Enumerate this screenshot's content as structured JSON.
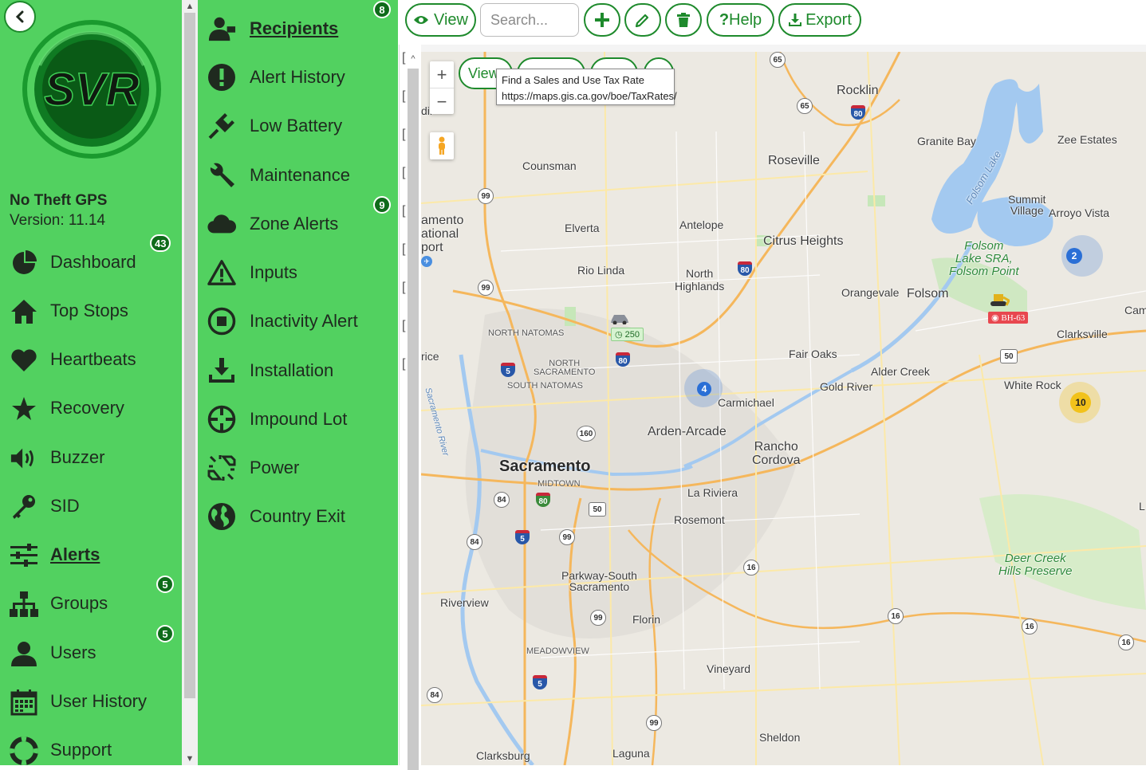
{
  "app": {
    "name": "No Theft GPS",
    "version": "Version: 11.14",
    "logo_text": "SVR"
  },
  "sidebar": {
    "items": [
      {
        "label": "Dashboard",
        "badge": "43",
        "icon": "dashboard-pie-icon"
      },
      {
        "label": "Top Stops",
        "badge": "",
        "icon": "home-icon"
      },
      {
        "label": "Heartbeats",
        "badge": "",
        "icon": "heart-icon"
      },
      {
        "label": "Recovery",
        "badge": "",
        "icon": "star-icon"
      },
      {
        "label": "Buzzer",
        "badge": "",
        "icon": "speaker-icon"
      },
      {
        "label": "SID",
        "badge": "",
        "icon": "key-icon"
      },
      {
        "label": "Alerts",
        "badge": "",
        "icon": "sliders-icon",
        "active": true
      },
      {
        "label": "Groups",
        "badge": "5",
        "icon": "sitemap-icon"
      },
      {
        "label": "Users",
        "badge": "5",
        "icon": "user-icon"
      },
      {
        "label": "User History",
        "badge": "",
        "icon": "calendar-icon"
      },
      {
        "label": "Support",
        "badge": "",
        "icon": "lifebuoy-icon"
      }
    ]
  },
  "alerts_menu": {
    "items": [
      {
        "label": "Recipients",
        "badge": "8",
        "icon": "recipients-icon",
        "active": true
      },
      {
        "label": "Alert History",
        "badge": "",
        "icon": "exclamation-circle-icon"
      },
      {
        "label": "Low Battery",
        "badge": "",
        "icon": "plug-icon"
      },
      {
        "label": "Maintenance",
        "badge": "",
        "icon": "wrench-icon"
      },
      {
        "label": "Zone Alerts",
        "badge": "9",
        "icon": "cloud-icon"
      },
      {
        "label": "Inputs",
        "badge": "",
        "icon": "warning-triangle-icon"
      },
      {
        "label": "Inactivity Alert",
        "badge": "",
        "icon": "stop-circle-icon"
      },
      {
        "label": "Installation",
        "badge": "",
        "icon": "download-icon"
      },
      {
        "label": "Impound Lot",
        "badge": "",
        "icon": "crosshair-icon"
      },
      {
        "label": "Power",
        "badge": "",
        "icon": "unplug-icon"
      },
      {
        "label": "Country Exit",
        "badge": "",
        "icon": "globe-icon"
      }
    ]
  },
  "toolbar": {
    "view_label": "View",
    "search_placeholder": "Search...",
    "help_label": "Help",
    "help_prefix": "?",
    "export_label": "Export"
  },
  "map": {
    "view_label": "View",
    "zoom_in": "+",
    "zoom_out": "−",
    "partial_text": "dir",
    "left_partial": [
      "amento",
      "ational",
      "port",
      "rice"
    ],
    "tooltip": {
      "line1": "Find a Sales and Use Tax Rate",
      "line2": "https://maps.gis.ca.gov/boe/TaxRates/"
    },
    "places": {
      "rocklin": "Rocklin",
      "granite_bay": "Granite Bay",
      "zee_estates": "Zee Estates",
      "roseville": "Roseville",
      "counsman": "Counsman",
      "summit_village": "Summit\nVillage",
      "arroyo_vista": "Arroyo Vista",
      "elverta": "Elverta",
      "antelope": "Antelope",
      "citrus_heights": "Citrus Heights",
      "rio_linda": "Rio Linda",
      "north_highlands": "North\nHighlands",
      "orangevale": "Orangevale",
      "folsom": "Folsom",
      "folsom_lake": "Folsom Lake",
      "folsom_sra": "Folsom\nLake SRA,\nFolsom Point",
      "cam": "Cam",
      "north_natomas": "NORTH NATOMAS",
      "clarksville": "Clarksville",
      "fair_oaks": "Fair Oaks",
      "north_sacramento": "NORTH\nSACRAMENTO",
      "south_natomas": "SOUTH NATOMAS",
      "alder_creek": "Alder Creek",
      "gold_river": "Gold River",
      "white_rock": "White Rock",
      "carmichael": "Carmichael",
      "arden_arcade": "Arden-Arcade",
      "rancho_cordova": "Rancho\nCordova",
      "sacramento": "Sacramento",
      "midtown": "MIDTOWN",
      "la_riviera": "La Riviera",
      "rosemont": "Rosemont",
      "deer_creek": "Deer Creek\nHills Preserve",
      "parkway": "Parkway-South\nSacramento",
      "riverview": "Riverview",
      "florin": "Florin",
      "meadowview": "MEADOWVIEW",
      "vineyard": "Vineyard",
      "sheldon": "Sheldon",
      "clarksburg": "Clarksburg",
      "laguna": "Laguna",
      "sacramento_river": "Sacramento River",
      "l_partial": "L"
    },
    "shields": [
      "65",
      "65",
      "80",
      "99",
      "80",
      "99",
      "80",
      "5",
      "80",
      "50",
      "160",
      "80",
      "84",
      "50",
      "5",
      "99",
      "84",
      "16",
      "16",
      "16",
      "16",
      "99",
      "5",
      "84",
      "99"
    ],
    "clusters": [
      {
        "count": "2",
        "color": "#2a6fd6"
      },
      {
        "count": "4",
        "color": "#2a6fd6"
      },
      {
        "count": "10",
        "color": "#f2c21b"
      }
    ],
    "vehicle_label": "250",
    "device_label": "BH-63"
  },
  "colors": {
    "sidebar_green": "#52d160",
    "accent_green": "#1e8a2c",
    "badge_green": "#0f6b1a"
  }
}
